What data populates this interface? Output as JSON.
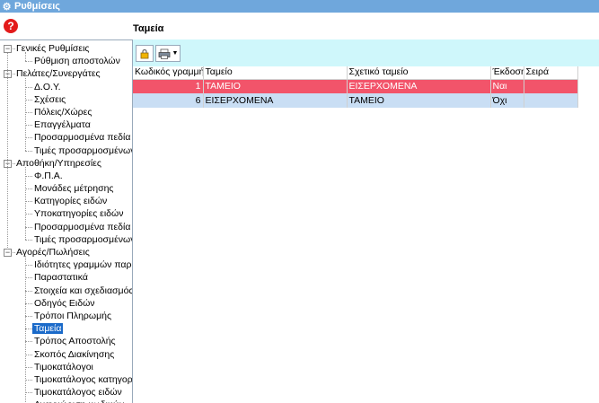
{
  "window": {
    "title": "Ρυθμίσεις"
  },
  "help": {
    "label": "?"
  },
  "content": {
    "title": "Ταμεία"
  },
  "tree": [
    {
      "type": "group",
      "label": "Γενικές Ρυθμίσεις"
    },
    {
      "type": "child",
      "label": "Ρύθμιση αποστολών"
    },
    {
      "type": "group",
      "label": "Πελάτες/Συνεργάτες"
    },
    {
      "type": "child",
      "label": "Δ.Ο.Υ."
    },
    {
      "type": "child",
      "label": "Σχέσεις"
    },
    {
      "type": "child",
      "label": "Πόλεις/Χώρες"
    },
    {
      "type": "child",
      "label": "Επαγγέλματα"
    },
    {
      "type": "child",
      "label": "Προσαρμοσμένα πεδία"
    },
    {
      "type": "child",
      "label": "Τιμές προσαρμοσμένων π"
    },
    {
      "type": "group",
      "label": "Αποθήκη/Υπηρεσίες"
    },
    {
      "type": "child",
      "label": "Φ.Π.Α."
    },
    {
      "type": "child",
      "label": "Μονάδες μέτρησης"
    },
    {
      "type": "child",
      "label": "Κατηγορίες ειδών"
    },
    {
      "type": "child",
      "label": "Υποκατηγορίες ειδών"
    },
    {
      "type": "child",
      "label": "Προσαρμοσμένα πεδία"
    },
    {
      "type": "child",
      "label": "Τιμές προσαρμοσμένων π"
    },
    {
      "type": "group",
      "label": "Αγορές/Πωλήσεις"
    },
    {
      "type": "child",
      "label": "Ιδιότητες γραμμών παρασ"
    },
    {
      "type": "child",
      "label": "Παραστατικά"
    },
    {
      "type": "child",
      "label": "Στοιχεία και σχεδιασμός π"
    },
    {
      "type": "child",
      "label": "Οδηγός Ειδών"
    },
    {
      "type": "child",
      "label": "Τρόποι Πληρωμής"
    },
    {
      "type": "child",
      "label": "Ταμεία",
      "selected": true
    },
    {
      "type": "child",
      "label": "Τρόπος Αποστολής"
    },
    {
      "type": "child",
      "label": "Σκοπός Διακίνησης"
    },
    {
      "type": "child",
      "label": "Τιμοκατάλογοι"
    },
    {
      "type": "child",
      "label": "Τιμοκατάλογος κατηγοριώ"
    },
    {
      "type": "child",
      "label": "Τιμοκατάλογος ειδών"
    },
    {
      "type": "child",
      "label": "Αναγνώριση κωδικών"
    }
  ],
  "toolbar": {
    "lock_icon": "lock-icon",
    "print_icon": "printer-icon"
  },
  "grid": {
    "columns": [
      "Κωδικός γραμμής",
      "Ταμείο",
      "Σχετικό ταμείο",
      "Έκδοση",
      "Σειρά"
    ],
    "rows": [
      {
        "code": "1",
        "tameio": "ΤΑΜΕΙΟ",
        "related": "ΕΙΣΕΡΧΟΜΕΝΑ",
        "ekdosi": "Ναι",
        "seira": "",
        "style": "red"
      },
      {
        "code": "6",
        "tameio": "ΕΙΣΕΡΧΟΜΕΝΑ",
        "related": "ΤΑΜΕΙΟ",
        "ekdosi": "Όχι",
        "seira": "",
        "style": "blue"
      }
    ]
  },
  "colors": {
    "titlebar": "#6fa7dc",
    "toolbar_bg": "#cff7fb",
    "selected_row": "#f2546a",
    "alt_row": "#c9def4",
    "tree_selected": "#1b6ac9"
  }
}
